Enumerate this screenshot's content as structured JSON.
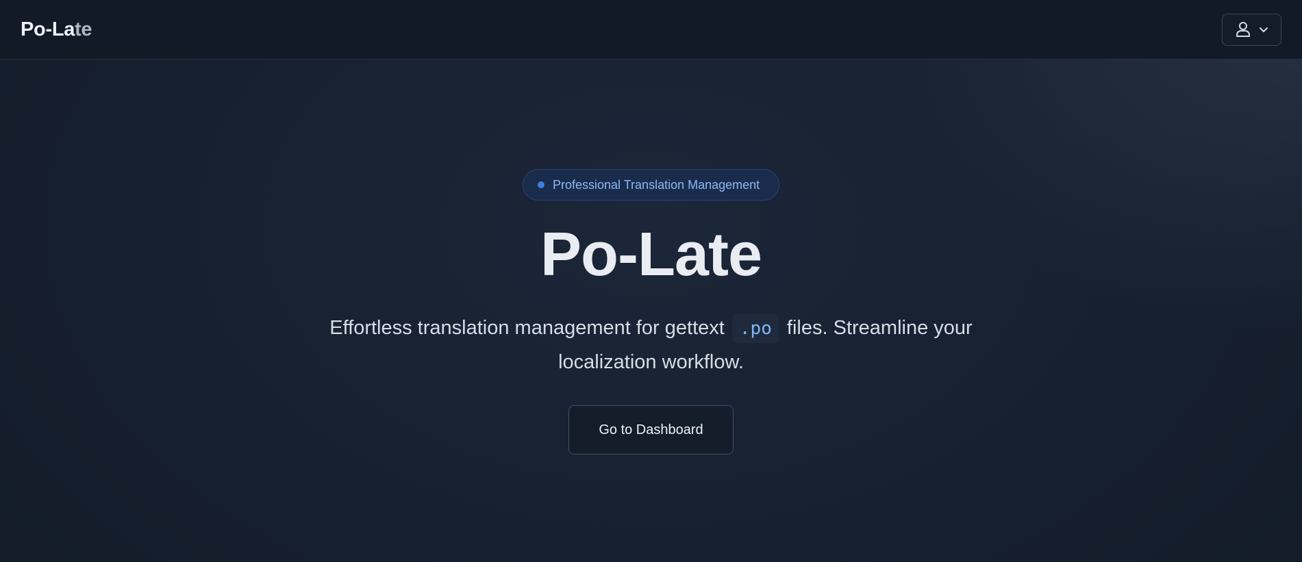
{
  "header": {
    "brand_main": "Po-La",
    "brand_fade": "te",
    "user_menu": {
      "icon": "user-icon",
      "chevron_icon": "chevron-down-icon"
    }
  },
  "hero": {
    "badge": "Professional Translation Management",
    "title": "Po-Late",
    "subtitle_before": "Effortless translation management for gettext",
    "subtitle_code": ".po",
    "subtitle_after": "files. Streamline your localization workflow.",
    "cta_label": "Go to Dashboard"
  },
  "colors": {
    "accent": "#3f7fe0",
    "badge_text": "#8fb8f2",
    "code_text": "#7fb6f5"
  }
}
